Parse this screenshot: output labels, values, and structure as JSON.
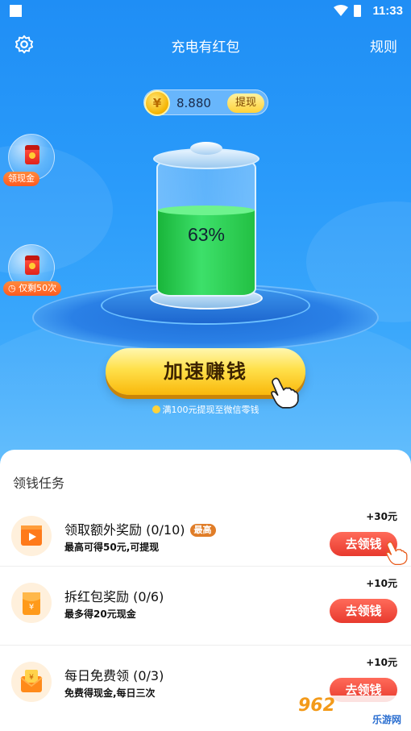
{
  "status": {
    "time": "11:33"
  },
  "nav": {
    "title": "充电有红包",
    "rules": "规则"
  },
  "balance": {
    "amount": "8.880",
    "withdraw": "提现",
    "coin_symbol": "¥"
  },
  "bubbles": [
    {
      "label": "领现金"
    },
    {
      "label": "仅剩50次"
    }
  ],
  "battery": {
    "percent": "63%",
    "level": 0.63
  },
  "speed_button": {
    "label": "加速赚钱"
  },
  "hint": "满100元提现至微信零钱",
  "tasks": {
    "section_title": "领钱任务",
    "items": [
      {
        "name": "领取额外奖励 (0/10)",
        "badge": "最高",
        "sub": "最高可得50元,可提现",
        "reward": "+30元",
        "button": "去领钱",
        "icon": "video-play-icon"
      },
      {
        "name": "拆红包奖励 (0/6)",
        "sub": "最多得20元现金",
        "reward": "+10元",
        "button": "去领钱",
        "icon": "red-envelope-icon"
      },
      {
        "name": "每日免费领 (0/3)",
        "sub": "免费得现金,每日三次",
        "reward": "+10元",
        "button": "去领钱",
        "icon": "gift-envelope-icon"
      }
    ]
  },
  "watermark": {
    "big": "962",
    "small": "乐游网"
  },
  "colors": {
    "hero_bg": "#1f8ef5",
    "button_yellow": "#ffe04a",
    "action_red": "#e83a2e",
    "battery_green": "#3de06a"
  }
}
